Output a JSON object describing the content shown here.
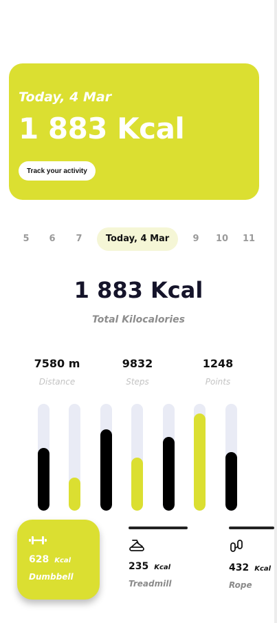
{
  "colors": {
    "accent": "#dbdf31",
    "dark": "#000000",
    "track": "#e9ebf5",
    "muted": "#9a9a9a"
  },
  "hero": {
    "date": "Today, 4 Mar",
    "kcal": "1 883 Kcal",
    "button_label": "Track your activity"
  },
  "days": [
    {
      "label": "5",
      "active": false
    },
    {
      "label": "6",
      "active": false
    },
    {
      "label": "7",
      "active": false
    },
    {
      "label": "Today, 4 Mar",
      "active": true
    },
    {
      "label": "9",
      "active": false
    },
    {
      "label": "10",
      "active": false
    },
    {
      "label": "11",
      "active": false
    }
  ],
  "summary": {
    "total": "1 883 Kcal",
    "label": "Total Kilocalories"
  },
  "stats": [
    {
      "value": "7580 m",
      "label": "Distance"
    },
    {
      "value": "9832",
      "label": "Steps"
    },
    {
      "value": "1248",
      "label": "Points"
    }
  ],
  "bars": [
    {
      "fraction": 0.59,
      "color": "dark"
    },
    {
      "fraction": 0.31,
      "color": "accent"
    },
    {
      "fraction": 0.76,
      "color": "dark"
    },
    {
      "fraction": 0.5,
      "color": "accent"
    },
    {
      "fraction": 0.69,
      "color": "dark"
    },
    {
      "fraction": 0.91,
      "color": "accent"
    },
    {
      "fraction": 0.55,
      "color": "dark"
    }
  ],
  "activities": [
    {
      "name": "Dumbbell",
      "value": "628",
      "unit": "Kcal",
      "icon": "dumbbell-icon",
      "active": true
    },
    {
      "name": "Treadmill",
      "value": "235",
      "unit": "Kcal",
      "icon": "treadmill-icon",
      "active": false
    },
    {
      "name": "Rope",
      "value": "432",
      "unit": "Kcal",
      "icon": "jump-rope-icon",
      "active": false
    }
  ]
}
